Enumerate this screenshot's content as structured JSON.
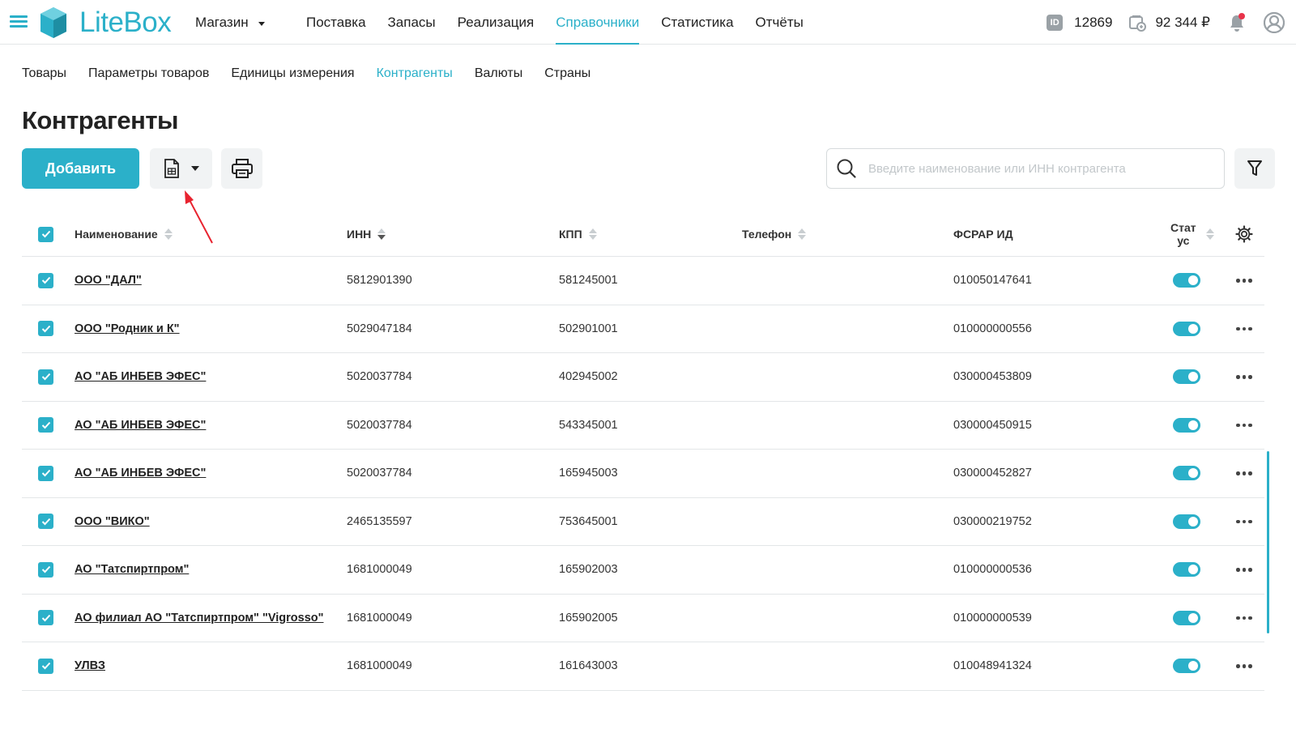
{
  "app": {
    "logo_text": "LiteBox",
    "store_label": "Магазин",
    "brand_color": "#2bb0c9"
  },
  "mainnav": {
    "items": [
      {
        "label": "Поставка",
        "active": false
      },
      {
        "label": "Запасы",
        "active": false
      },
      {
        "label": "Реализация",
        "active": false
      },
      {
        "label": "Справочники",
        "active": true
      },
      {
        "label": "Статистика",
        "active": false
      },
      {
        "label": "Отчёты",
        "active": false
      }
    ]
  },
  "account": {
    "id_badge": "ID",
    "id_value": "12869",
    "balance": "92 344 ₽"
  },
  "subnav": {
    "items": [
      {
        "label": "Товары",
        "active": false
      },
      {
        "label": "Параметры товаров",
        "active": false
      },
      {
        "label": "Единицы измерения",
        "active": false
      },
      {
        "label": "Контрагенты",
        "active": true
      },
      {
        "label": "Валюты",
        "active": false
      },
      {
        "label": "Страны",
        "active": false
      }
    ]
  },
  "page": {
    "title": "Контрагенты"
  },
  "toolbar": {
    "add_label": "Добавить",
    "search_placeholder": "Введите наименование или ИНН контрагента"
  },
  "table": {
    "columns": {
      "name": "Наименование",
      "inn": "ИНН",
      "kpp": "КПП",
      "phone": "Телефон",
      "fsrar": "ФСРАР ИД",
      "status_line1": "Стат",
      "status_line2": "ус"
    },
    "rows": [
      {
        "name": "ООО \"ДАЛ\"",
        "inn": "5812901390",
        "kpp": "581245001",
        "phone": "",
        "fsrar": "010050147641",
        "status": true,
        "checked": true
      },
      {
        "name": "ООО \"Родник и К\"",
        "inn": "5029047184",
        "kpp": "502901001",
        "phone": "",
        "fsrar": "010000000556",
        "status": true,
        "checked": true
      },
      {
        "name": "АО \"АБ ИНБЕВ ЭФЕС\"",
        "inn": "5020037784",
        "kpp": "402945002",
        "phone": "",
        "fsrar": "030000453809",
        "status": true,
        "checked": true
      },
      {
        "name": "АО \"АБ ИНБЕВ ЭФЕС\"",
        "inn": "5020037784",
        "kpp": "543345001",
        "phone": "",
        "fsrar": "030000450915",
        "status": true,
        "checked": true
      },
      {
        "name": "АО \"АБ ИНБЕВ ЭФЕС\"",
        "inn": "5020037784",
        "kpp": "165945003",
        "phone": "",
        "fsrar": "030000452827",
        "status": true,
        "checked": true
      },
      {
        "name": "ООО \"ВИКО\"",
        "inn": "2465135597",
        "kpp": "753645001",
        "phone": "",
        "fsrar": "030000219752",
        "status": true,
        "checked": true
      },
      {
        "name": "АО \"Татспиртпром\"",
        "inn": "1681000049",
        "kpp": "165902003",
        "phone": "",
        "fsrar": "010000000536",
        "status": true,
        "checked": true
      },
      {
        "name": "АО филиал АО \"Татспиртпром\" \"Vigrosso\"",
        "inn": "1681000049",
        "kpp": "165902005",
        "phone": "",
        "fsrar": "010000000539",
        "status": true,
        "checked": true
      },
      {
        "name": "УЛВЗ",
        "inn": "1681000049",
        "kpp": "161643003",
        "phone": "",
        "fsrar": "010048941324",
        "status": true,
        "checked": true
      }
    ]
  }
}
